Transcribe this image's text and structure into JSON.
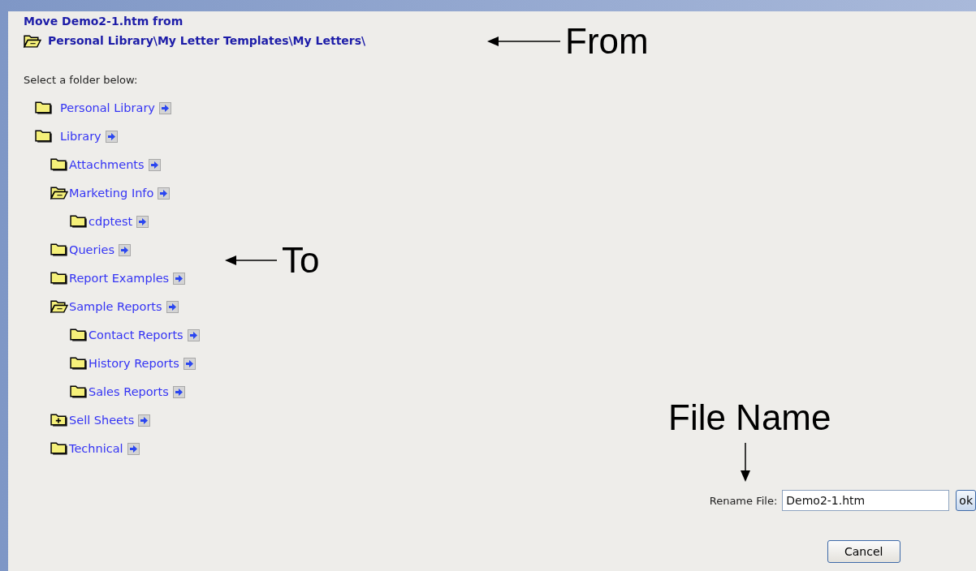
{
  "header": {
    "title": "Move Demo2-1.htm from",
    "path": "Personal Library\\My Letter Templates\\My Letters\\"
  },
  "prompt": "Select a folder below:",
  "tree": [
    {
      "label": "Personal Library",
      "kind": "closed"
    },
    {
      "label": "Library",
      "kind": "closed",
      "children": [
        {
          "label": "Attachments",
          "kind": "closed"
        },
        {
          "label": "Marketing Info",
          "kind": "open",
          "children": [
            {
              "label": "cdptest",
              "kind": "closed"
            }
          ]
        },
        {
          "label": "Queries",
          "kind": "closed"
        },
        {
          "label": "Report Examples",
          "kind": "closed"
        },
        {
          "label": "Sample Reports",
          "kind": "open",
          "children": [
            {
              "label": "Contact Reports",
              "kind": "closed"
            },
            {
              "label": "History Reports",
              "kind": "closed"
            },
            {
              "label": "Sales Reports",
              "kind": "closed"
            }
          ]
        },
        {
          "label": "Sell Sheets",
          "kind": "plus"
        },
        {
          "label": "Technical",
          "kind": "closed"
        }
      ]
    }
  ],
  "rename": {
    "label": "Rename File:",
    "value": "Demo2-1.htm",
    "ok": "ok"
  },
  "cancel": "Cancel",
  "annotations": [
    {
      "text": "From",
      "kind": "left"
    },
    {
      "text": "To",
      "kind": "left"
    },
    {
      "text": "File Name",
      "kind": "down"
    }
  ]
}
